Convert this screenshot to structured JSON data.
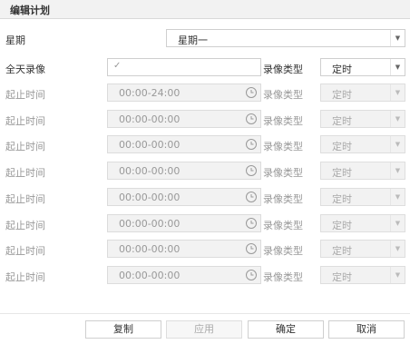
{
  "dialog": {
    "title": "编辑计划"
  },
  "day": {
    "label": "星期",
    "value": "星期一"
  },
  "allday": {
    "label": "全天录像",
    "checked": true,
    "type_label": "录像类型",
    "type_value": "定时"
  },
  "time_rows": [
    {
      "label": "起止时间",
      "time": "00:00-24:00",
      "type_label": "录像类型",
      "type_value": "定时"
    },
    {
      "label": "起止时间",
      "time": "00:00-00:00",
      "type_label": "录像类型",
      "type_value": "定时"
    },
    {
      "label": "起止时间",
      "time": "00:00-00:00",
      "type_label": "录像类型",
      "type_value": "定时"
    },
    {
      "label": "起止时间",
      "time": "00:00-00:00",
      "type_label": "录像类型",
      "type_value": "定时"
    },
    {
      "label": "起止时间",
      "time": "00:00-00:00",
      "type_label": "录像类型",
      "type_value": "定时"
    },
    {
      "label": "起止时间",
      "time": "00:00-00:00",
      "type_label": "录像类型",
      "type_value": "定时"
    },
    {
      "label": "起止时间",
      "time": "00:00-00:00",
      "type_label": "录像类型",
      "type_value": "定时"
    },
    {
      "label": "起止时间",
      "time": "00:00-00:00",
      "type_label": "录像类型",
      "type_value": "定时"
    }
  ],
  "buttons": {
    "copy": "复制",
    "apply": "应用",
    "ok": "确定",
    "cancel": "取消"
  },
  "icons": {
    "dropdown": "chevron-down-icon",
    "clock": "clock-icon",
    "check": "check-icon"
  }
}
